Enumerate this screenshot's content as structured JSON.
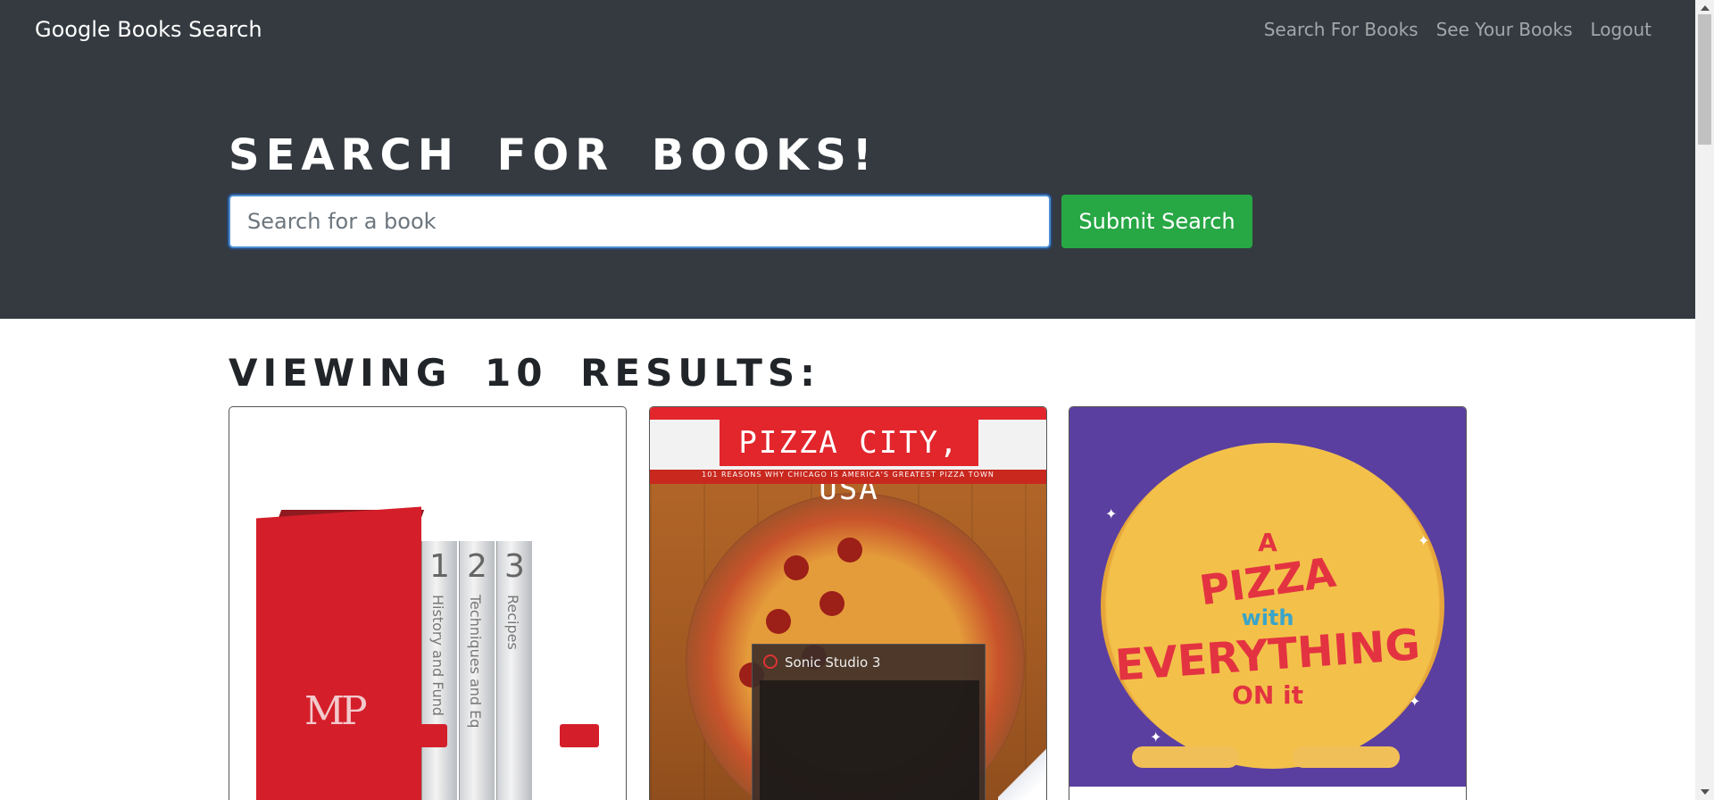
{
  "navbar": {
    "brand": "Google Books Search",
    "links": [
      {
        "label": "Search For Books"
      },
      {
        "label": "See Your Books"
      },
      {
        "label": "Logout"
      }
    ]
  },
  "hero": {
    "title": "Search for Books!",
    "search_placeholder": "Search for a book",
    "search_value": "",
    "submit_label": "Submit Search"
  },
  "results": {
    "heading": "Viewing 10 results:",
    "cards": [
      {
        "cover_text": "MP",
        "volume_numbers": [
          "1",
          "2",
          "3"
        ],
        "spine_labels": [
          "History and Fund",
          "Techniques and Eq",
          "Recipes"
        ]
      },
      {
        "cover_title": "PIZZA CITY, USA",
        "cover_subtitle": "101 REASONS WHY CHICAGO IS AMERICA'S GREATEST PIZZA TOWN",
        "overlay_title": "Sonic Studio 3"
      },
      {
        "cover_lines": [
          "A",
          "PIZZA",
          "with",
          "EVERYTHING",
          "ON it"
        ]
      }
    ]
  },
  "colors": {
    "navbar_bg": "#343a40",
    "submit_bg": "#28a745"
  }
}
